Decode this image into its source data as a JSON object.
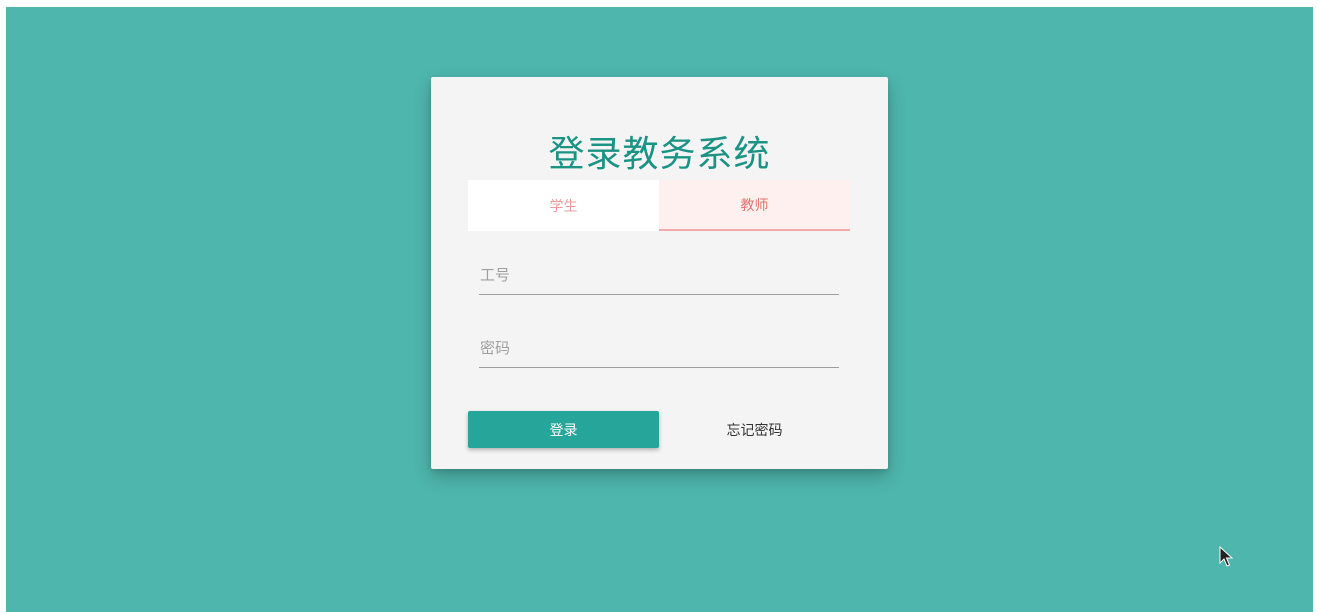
{
  "login_card": {
    "title": "登录教务系统",
    "tabs": [
      {
        "label": "学生",
        "active": false
      },
      {
        "label": "教师",
        "active": true
      }
    ],
    "fields": {
      "username_placeholder": "工号",
      "username_value": "",
      "password_placeholder": "密码",
      "password_value": ""
    },
    "login_button_label": "登录",
    "forgot_password_label": "忘记密码"
  },
  "colors": {
    "background": "#4eb6ad",
    "card": "#f4f4f4",
    "title": "#1a9384",
    "primary_button": "#26a69a",
    "tab_text": "#ef9a9a",
    "active_tab_bg": "#fdf0ef",
    "active_tab_underline": "#f2aaaa"
  },
  "cursor_icon": "mouse-pointer-icon"
}
